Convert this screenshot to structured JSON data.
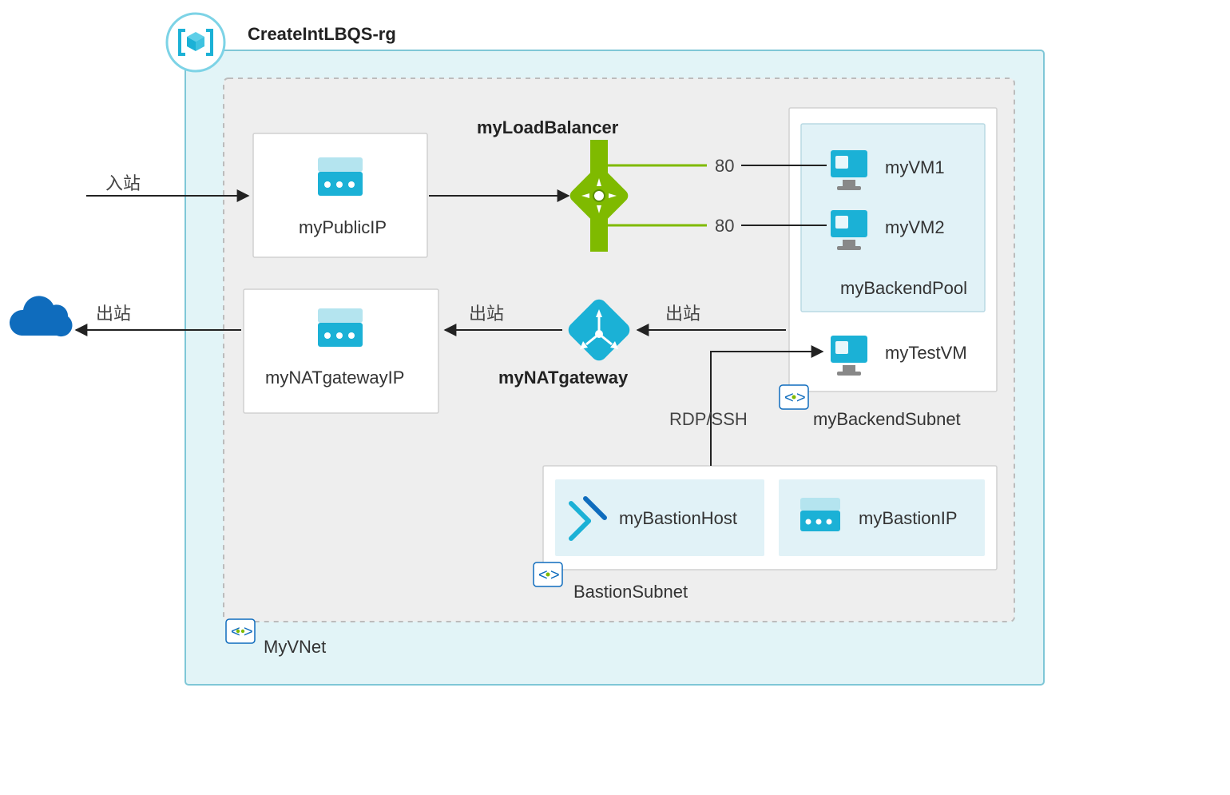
{
  "title": "CreateIntLBQS-rg",
  "vnet_label": "MyVNet",
  "public_ip": "myPublicIP",
  "nat_gw_ip": "myNATgatewayIP",
  "nat_gw": "myNATgateway",
  "lb": "myLoadBalancer",
  "backend_pool": "myBackendPool",
  "vm1": "myVM1",
  "vm2": "myVM2",
  "test_vm": "myTestVM",
  "backend_subnet": "myBackendSubnet",
  "bastion_subnet": "BastionSubnet",
  "bastion_host": "myBastionHost",
  "bastion_ip": "myBastionIP",
  "port1": "80",
  "port2": "80",
  "inbound": "入站",
  "outbound1": "出站",
  "outbound2": "出站",
  "outbound3": "出站",
  "rdp_ssh": "RDP/SSH",
  "colors": {
    "teal_light": "#5ecfe8",
    "teal_dark": "#1bb1d6",
    "green": "#7fba00",
    "green_dark": "#5a8f00",
    "vnet_bg": "#e2f4f7",
    "vnet_border": "#7fc7d7",
    "rg_border": "#bcbcbc",
    "rg_bg": "#eeeeee",
    "cloud": "#0f6cbd"
  }
}
